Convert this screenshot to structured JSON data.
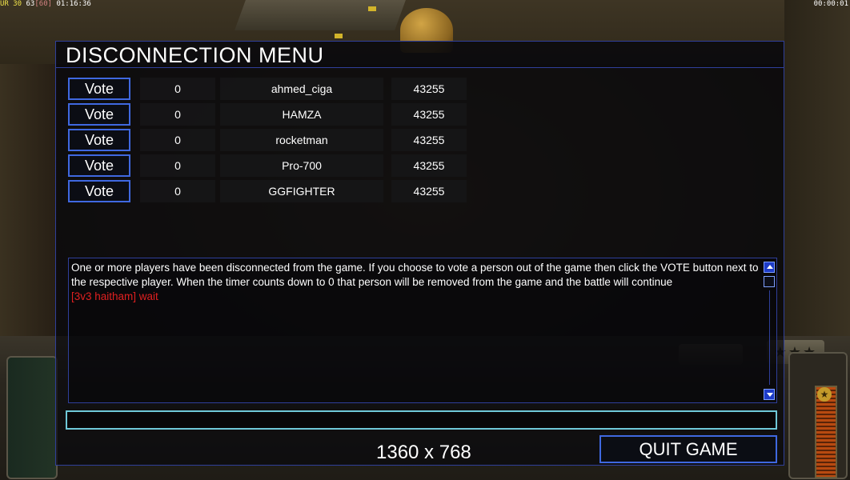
{
  "hud": {
    "left_a": "UR 30",
    "left_b": "63",
    "left_c": "[60]",
    "left_time": "01:16:36",
    "right_time": "00:00:01"
  },
  "console": {
    "stars": "★★★",
    "badge": "★"
  },
  "dialog": {
    "title": "DISCONNECTION MENU",
    "vote_label": "Vote",
    "players": [
      {
        "votes": "0",
        "name": "ahmed_ciga",
        "ping": "43255"
      },
      {
        "votes": "0",
        "name": "HAMZA",
        "ping": "43255"
      },
      {
        "votes": "0",
        "name": "rocketman",
        "ping": "43255"
      },
      {
        "votes": "0",
        "name": "Pro-700",
        "ping": "43255"
      },
      {
        "votes": "0",
        "name": "GGFIGHTER",
        "ping": "43255"
      }
    ],
    "message": "One or more players have been disconnected from the game. If you choose to vote a person out of the game then click the VOTE button next to the respective player. When the timer counts down to 0 that person will be removed from the game and the battle will continue",
    "chat_line": "[3v3 haitham] wait",
    "chat_input_value": "",
    "resolution": "1360 x 768",
    "quit_label": "QUIT GAME"
  },
  "colors": {
    "accent_border": "#3f68e0",
    "chat_red": "#e02020",
    "input_border": "#6fc8d8"
  }
}
